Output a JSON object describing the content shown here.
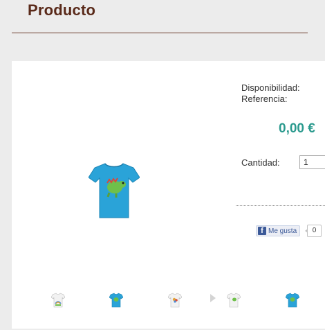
{
  "page": {
    "title": "Producto"
  },
  "product": {
    "availability_label": "Disponibilidad:",
    "reference_label": "Referencia:",
    "price": "0,00 €",
    "quantity_label": "Cantidad:",
    "quantity_value": "1",
    "main_image_alt": "blue t-shirt with green dinosaur print"
  },
  "social": {
    "like_label": "Me gusta",
    "like_count": "0"
  },
  "thumbnails": [
    {
      "name": "white shirt with rainbow print",
      "shirt_color": "#f2f2f2",
      "print_color": "#4a8ad6"
    },
    {
      "name": "blue shirt with dinosaur print",
      "shirt_color": "#2aa3d8",
      "print_color": "#6fc04a"
    },
    {
      "name": "white shirt with colorful print",
      "shirt_color": "#f2f2f2",
      "print_color": "#e0a43a"
    },
    {
      "name": "white shirt with green print",
      "shirt_color": "#f2f2f2",
      "print_color": "#6fc04a"
    },
    {
      "name": "blue shirt with dinosaur print",
      "shirt_color": "#2aa3d8",
      "print_color": "#6fc04a"
    }
  ],
  "colors": {
    "title": "#5a2a1a",
    "price": "#2b9a8e",
    "shirt_blue": "#2aa3d8",
    "facebook": "#3b5998"
  }
}
